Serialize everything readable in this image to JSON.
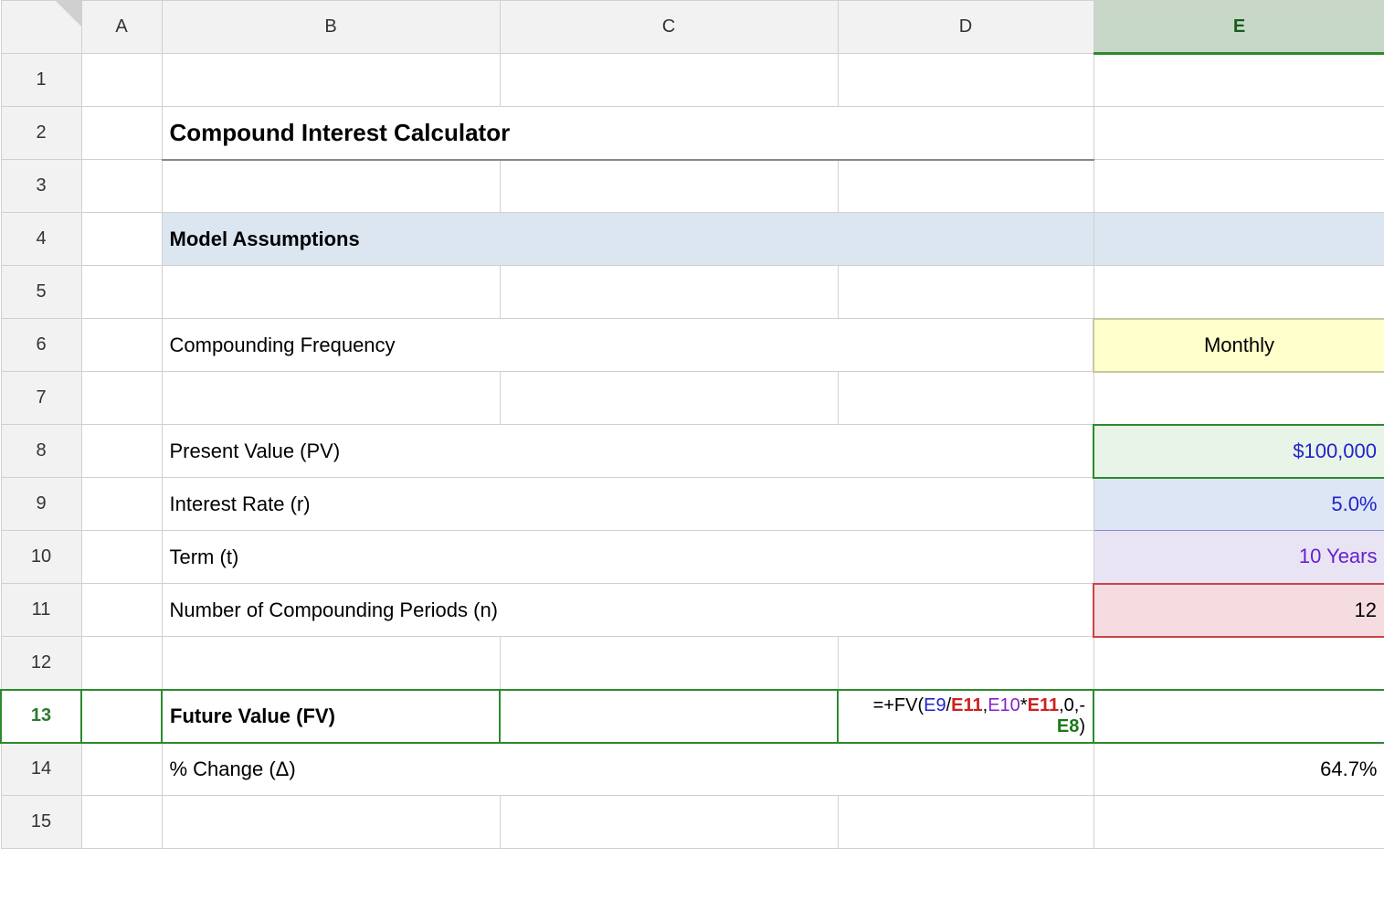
{
  "columns": {
    "corner": "",
    "a": "A",
    "b": "B",
    "c": "C",
    "d": "D",
    "e": "E"
  },
  "rows": {
    "r1": {
      "num": "1"
    },
    "r2": {
      "num": "2",
      "b": "Compound Interest Calculator"
    },
    "r3": {
      "num": "3"
    },
    "r4": {
      "num": "4",
      "b": "Model Assumptions"
    },
    "r5": {
      "num": "5"
    },
    "r6": {
      "num": "6",
      "b": "Compounding Frequency",
      "e": "Monthly"
    },
    "r7": {
      "num": "7"
    },
    "r8": {
      "num": "8",
      "b": "Present Value (PV)",
      "e": "$100,000"
    },
    "r9": {
      "num": "9",
      "b": "Interest Rate (r)",
      "e": "5.0%"
    },
    "r10": {
      "num": "10",
      "b": "Term (t)",
      "e": "10 Years"
    },
    "r11": {
      "num": "11",
      "b": "Number of Compounding Periods (n)",
      "e": "12"
    },
    "r12": {
      "num": "12"
    },
    "r13": {
      "num": "13",
      "b": "Future Value (FV)",
      "e_formula": "=+FV(E9/E11,E10*E11,0,-E8)"
    },
    "r14": {
      "num": "14",
      "b": "% Change (Δ)",
      "e": "64.7%"
    },
    "r15": {
      "num": "15"
    }
  }
}
